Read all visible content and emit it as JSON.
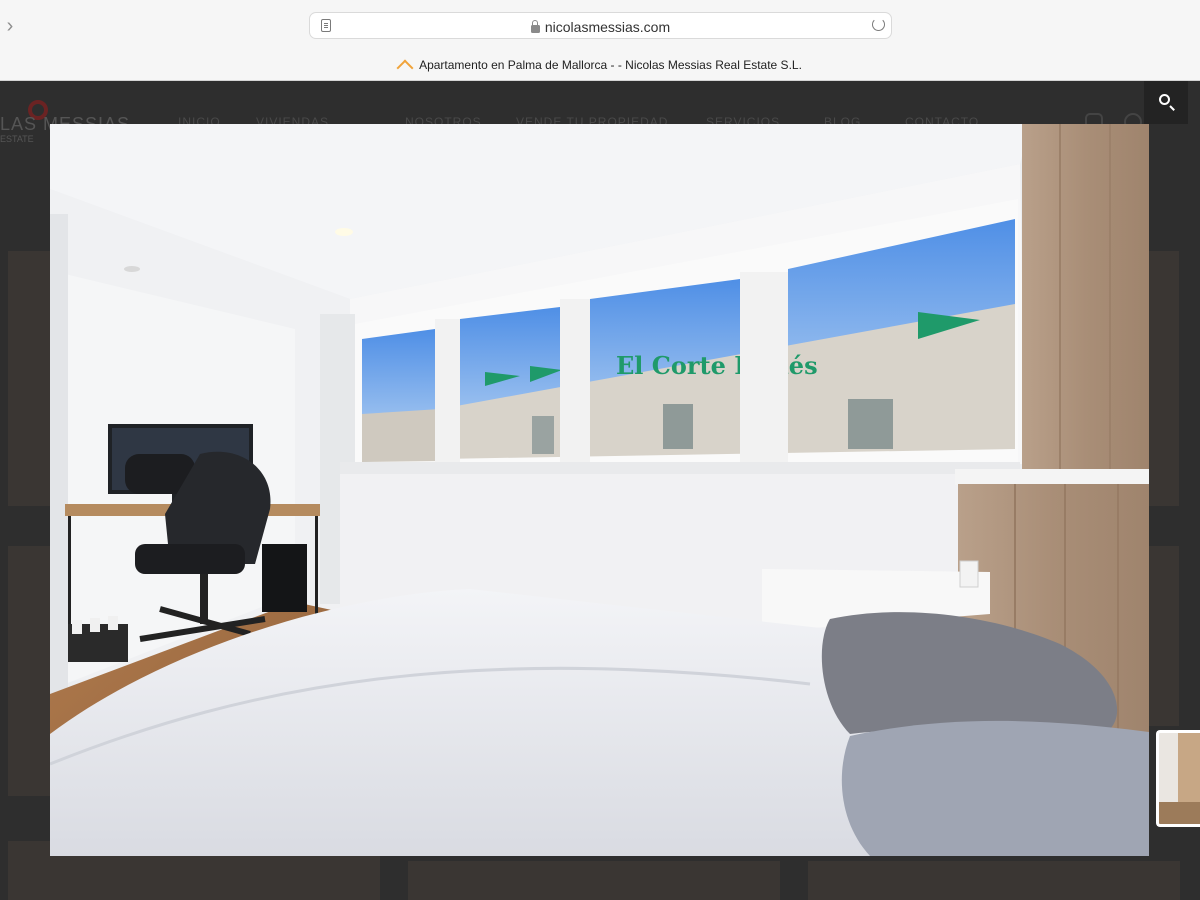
{
  "browser": {
    "back_glyph": "›",
    "url": "nicolasmessias.com",
    "tab_title": "Apartamento en Palma de Mallorca - - Nicolas Messias Real Estate S.L.",
    "icons": [
      "reader-icon",
      "lock-icon",
      "reload-icon",
      "favicon-roof-icon"
    ]
  },
  "site": {
    "logo_text": "LAS MESSIAS",
    "logo_sub": "ESTATE",
    "nav_items": [
      "INICIO",
      "VIVIENDAS",
      "NOSOTROS",
      "VENDE TU PROPIEDAD",
      "SERVICIOS",
      "BLOG",
      "CONTACTO"
    ],
    "search_icon": "search-icon"
  },
  "lightbox": {
    "image_alt": "Bedroom with desk, office chair, large windows and double bed",
    "sign_text": "El Corte Inglés",
    "colors": {
      "wood": "#a98e77",
      "sky": "#5f9fe8",
      "sign_green": "#1f9a6a"
    }
  }
}
